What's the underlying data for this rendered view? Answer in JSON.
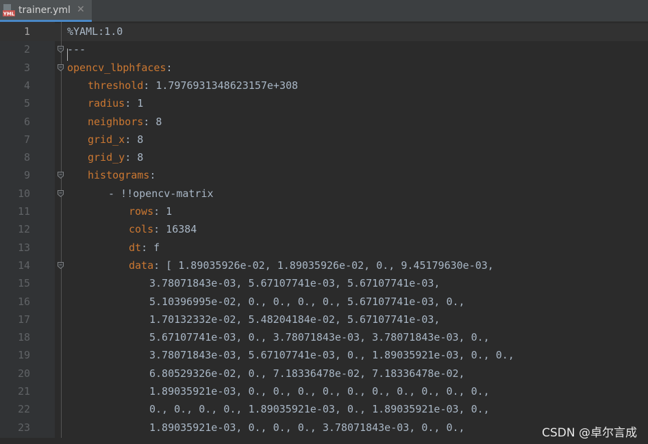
{
  "tab": {
    "icon": "yml-file-icon",
    "icon_text": "YML",
    "label": "trainer.yml",
    "close_glyph": "✕"
  },
  "lines": [
    {
      "n": "1",
      "indent": 0,
      "key": "",
      "value": "%YAML:1.0",
      "fold": false
    },
    {
      "n": "2",
      "indent": 0,
      "key": "",
      "value": "---",
      "fold": true
    },
    {
      "n": "3",
      "indent": 0,
      "key": "opencv_lbphfaces",
      "value": ":",
      "fold": true
    },
    {
      "n": "4",
      "indent": 1,
      "key": "threshold",
      "value": ": 1.7976931348623157e+308",
      "fold": false
    },
    {
      "n": "5",
      "indent": 1,
      "key": "radius",
      "value": ": 1",
      "fold": false
    },
    {
      "n": "6",
      "indent": 1,
      "key": "neighbors",
      "value": ": 8",
      "fold": false
    },
    {
      "n": "7",
      "indent": 1,
      "key": "grid_x",
      "value": ": 8",
      "fold": false
    },
    {
      "n": "8",
      "indent": 1,
      "key": "grid_y",
      "value": ": 8",
      "fold": false
    },
    {
      "n": "9",
      "indent": 1,
      "key": "histograms",
      "value": ":",
      "fold": true
    },
    {
      "n": "10",
      "indent": 2,
      "key": "",
      "value": "- !!opencv-matrix",
      "fold": true
    },
    {
      "n": "11",
      "indent": 3,
      "key": "rows",
      "value": ": 1",
      "fold": false
    },
    {
      "n": "12",
      "indent": 3,
      "key": "cols",
      "value": ": 16384",
      "fold": false
    },
    {
      "n": "13",
      "indent": 3,
      "key": "dt",
      "value": ": f",
      "fold": false
    },
    {
      "n": "14",
      "indent": 3,
      "key": "data",
      "value": ": [ 1.89035926e-02, 1.89035926e-02, 0., 9.45179630e-03,",
      "fold": true
    },
    {
      "n": "15",
      "indent": 4,
      "key": "",
      "value": "3.78071843e-03, 5.67107741e-03, 5.67107741e-03,",
      "fold": false
    },
    {
      "n": "16",
      "indent": 4,
      "key": "",
      "value": "5.10396995e-02, 0., 0., 0., 0., 5.67107741e-03, 0.,",
      "fold": false
    },
    {
      "n": "17",
      "indent": 4,
      "key": "",
      "value": "1.70132332e-02, 5.48204184e-02, 5.67107741e-03,",
      "fold": false
    },
    {
      "n": "18",
      "indent": 4,
      "key": "",
      "value": "5.67107741e-03, 0., 3.78071843e-03, 3.78071843e-03, 0.,",
      "fold": false
    },
    {
      "n": "19",
      "indent": 4,
      "key": "",
      "value": "3.78071843e-03, 5.67107741e-03, 0., 1.89035921e-03, 0., 0.,",
      "fold": false
    },
    {
      "n": "20",
      "indent": 4,
      "key": "",
      "value": "6.80529326e-02, 0., 7.18336478e-02, 7.18336478e-02,",
      "fold": false
    },
    {
      "n": "21",
      "indent": 4,
      "key": "",
      "value": "1.89035921e-03, 0., 0., 0., 0., 0., 0., 0., 0., 0., 0.,",
      "fold": false
    },
    {
      "n": "22",
      "indent": 4,
      "key": "",
      "value": "0., 0., 0., 0., 1.89035921e-03, 0., 1.89035921e-03, 0.,",
      "fold": false
    },
    {
      "n": "23",
      "indent": 4,
      "key": "",
      "value": "1.89035921e-03, 0., 0., 0., 3.78071843e-03, 0., 0.,",
      "fold": false
    }
  ],
  "watermark": "CSDN @卓尔言成",
  "colors": {
    "background": "#2b2b2b",
    "key": "#cc7832",
    "text": "#a9b7c6",
    "line_number": "#606366"
  }
}
